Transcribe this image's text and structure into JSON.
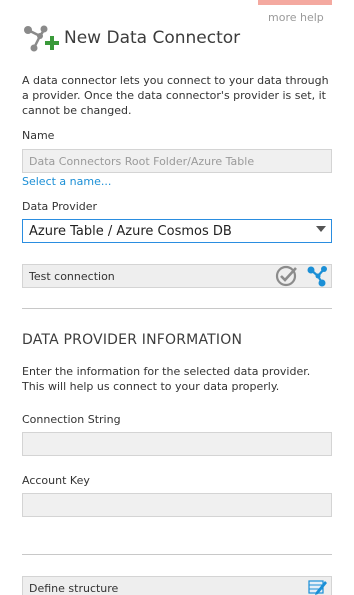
{
  "header": {
    "help_label": "more help",
    "title": "New Data Connector",
    "icon": "data-connector-add-icon"
  },
  "intro": {
    "text": "A data connector lets you connect to your data through a provider. Once the data connector's provider is set, it cannot be changed."
  },
  "name_field": {
    "label": "Name",
    "placeholder": "Data Connectors Root Folder/Azure Table",
    "select_link": "Select a name..."
  },
  "provider_field": {
    "label": "Data Provider",
    "selected": "Azure Table / Azure Cosmos DB"
  },
  "test_connection": {
    "label": "Test connection",
    "icons": [
      "check-circle-icon",
      "connection-icon"
    ]
  },
  "provider_info": {
    "title": "DATA PROVIDER INFORMATION",
    "text": "Enter the information for the selected data provider. This will help us connect to your data properly."
  },
  "connection_string": {
    "label": "Connection String",
    "value": ""
  },
  "account_key": {
    "label": "Account Key",
    "value": ""
  },
  "define_structure": {
    "label": "Define structure",
    "icon": "edit-structure-icon"
  },
  "colors": {
    "accent": "#1b8fd6",
    "focus_border": "#2a8de0",
    "help_tab": "#f4a9a0",
    "add_green": "#3a9a3a"
  }
}
